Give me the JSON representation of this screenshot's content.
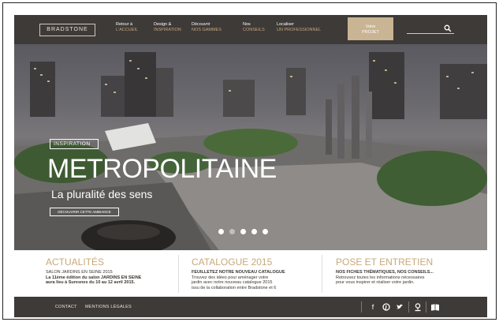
{
  "header": {
    "logo": "BRADSTONE",
    "nav": [
      {
        "top": "Retour à",
        "bottom": "L'ACCUEIL"
      },
      {
        "top": "Design &",
        "bottom": "INSPIRATION"
      },
      {
        "top": "Découvrir",
        "bottom": "NOS GAMMES"
      },
      {
        "top": "Nos",
        "bottom": "CONSEILS"
      },
      {
        "top": "Localiser",
        "bottom": "UN PROFESSIONNEL"
      }
    ],
    "cta_line1": "Votre",
    "cta_line2": "PROJET",
    "search_icon": "search-icon"
  },
  "hero": {
    "tag": "INSPIRATION",
    "title": "METROPOLITAINE",
    "subtitle": "La pluralité des sens",
    "button": "DÉCOUVRIR CETTE AMBIANCE",
    "slide_count": 5,
    "active_slide": 1
  },
  "columns": [
    {
      "title": "ACTUALITÉS",
      "lines": [
        "SALON JARDINS EN SEINE 2015",
        "La 11ème édition du salon JARDINS EN SEINE",
        "aura lieu à Suresnes du 10 au 12 avril 2015."
      ]
    },
    {
      "title": "CATALOGUE 2015",
      "lines": [
        "FEUILLETEZ NOTRE NOUVEAU CATALOGUE",
        "Trouvez des idées pour aménager votre",
        "jardin avec notre nouveau catalogue 2015",
        "issu de la collaboration entre Bradstone et 6"
      ]
    },
    {
      "title": "POSE ET ENTRETIEN",
      "lines": [
        "NOS FICHES THÉMATIQUES, NOS CONSEILS...",
        "Retrouvez toutes les informations nécessaires",
        "pour vous inspirer et réaliser votre jardin."
      ]
    }
  ],
  "footer": {
    "links": [
      "CONTACT",
      "MENTIONS LÉGALES"
    ],
    "social": [
      {
        "name": "facebook-icon",
        "glyph": "f"
      },
      {
        "name": "pinterest-icon",
        "glyph": "℗"
      },
      {
        "name": "twitter-icon",
        "glyph": "🐦"
      },
      {
        "name": "locator-icon",
        "glyph": "⌖"
      },
      {
        "name": "catalogue-icon",
        "glyph": "📖"
      }
    ]
  },
  "colors": {
    "header_bg": "#3e3a37",
    "accent_gold": "#c9a87a",
    "cta_bg": "#c9b493"
  }
}
